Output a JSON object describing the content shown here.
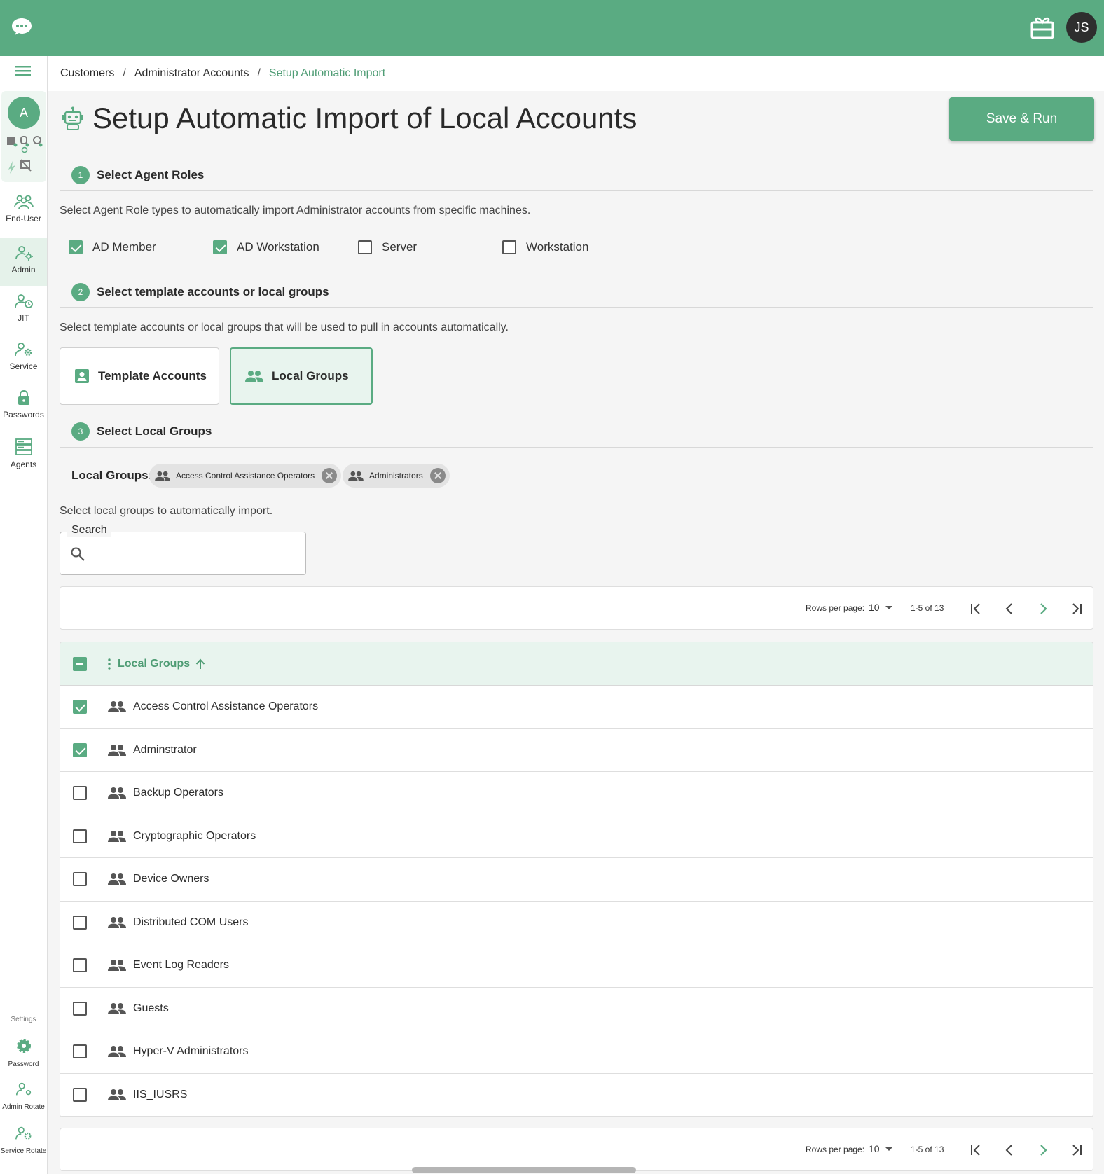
{
  "header": {
    "user_initials": "JS"
  },
  "sidebar": {
    "context_initial": "A",
    "items": [
      {
        "label": "End-User"
      },
      {
        "label": "Admin"
      },
      {
        "label": "JIT"
      },
      {
        "label": "Service"
      },
      {
        "label": "Passwords"
      },
      {
        "label": "Agents"
      }
    ],
    "settings_label": "Settings",
    "settings_items": [
      {
        "label": "Password"
      },
      {
        "label": "Admin Rotate"
      },
      {
        "label": "Service Rotate"
      }
    ]
  },
  "breadcrumb": [
    "Customers",
    "Administrator Accounts",
    "Setup Automatic Import"
  ],
  "page": {
    "title": "Setup Automatic Import of Local Accounts",
    "save_button": "Save & Run"
  },
  "step1": {
    "number": "1",
    "title": "Select Agent Roles",
    "description": "Select Agent Role types to automatically import Administrator accounts from specific machines.",
    "roles": [
      {
        "label": "AD Member",
        "checked": true
      },
      {
        "label": "AD Workstation",
        "checked": true
      },
      {
        "label": "Server",
        "checked": false
      },
      {
        "label": "Workstation",
        "checked": false
      }
    ]
  },
  "step2": {
    "number": "2",
    "title": "Select template accounts or local groups",
    "description": "Select template accounts or local groups that will be used to pull in accounts automatically.",
    "options": [
      {
        "label": "Template Accounts",
        "selected": false
      },
      {
        "label": "Local Groups",
        "selected": true
      }
    ]
  },
  "step3": {
    "number": "3",
    "title": "Select Local Groups",
    "chips_label": "Local Groups:",
    "chips": [
      "Access Control Assistance Operators",
      "Administrators"
    ],
    "description": "Select local groups to automatically import.",
    "search": {
      "label": "Search",
      "value": ""
    }
  },
  "pagination": {
    "rows_per_page_label": "Rows per page:",
    "rows_per_page": "10",
    "range": "1-5 of 13"
  },
  "table": {
    "column": "Local Groups",
    "rows": [
      {
        "name": "Access Control Assistance Operators",
        "checked": true
      },
      {
        "name": "Adminstrator",
        "checked": true
      },
      {
        "name": "Backup Operators",
        "checked": false
      },
      {
        "name": "Cryptographic Operators",
        "checked": false
      },
      {
        "name": "Device Owners",
        "checked": false
      },
      {
        "name": "Distributed COM Users",
        "checked": false
      },
      {
        "name": "Event Log Readers",
        "checked": false
      },
      {
        "name": "Guests",
        "checked": false
      },
      {
        "name": "Hyper-V Administrators",
        "checked": false
      },
      {
        "name": "IIS_IUSRS",
        "checked": false
      }
    ]
  },
  "colors": {
    "accent": "#5aab82",
    "accent_text": "#4e9c74",
    "accent_light": "#e8f4ee"
  }
}
